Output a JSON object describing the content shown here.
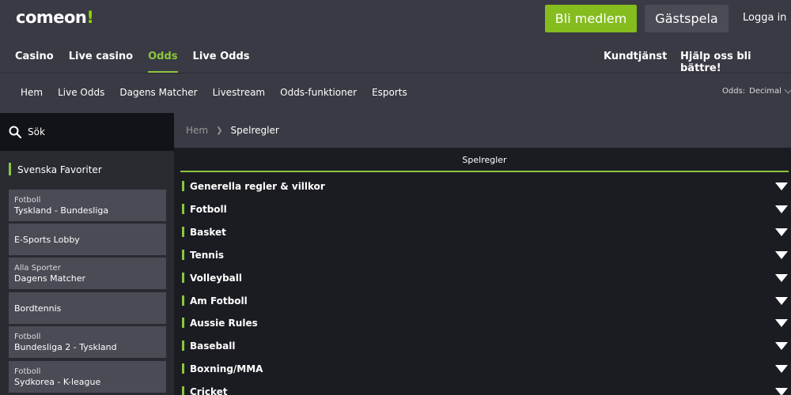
{
  "header": {
    "logo_main": "comeon",
    "logo_suffix": "!",
    "join_label": "Bli medlem",
    "guest_label": "Gästspela",
    "login_label": "Logga in",
    "nav": [
      "Casino",
      "Live casino",
      "Odds",
      "Live Odds"
    ],
    "active_nav": "Odds",
    "support_label": "Kundtjänst",
    "feedback_label": "Hjälp oss bli bättre!"
  },
  "subnav": {
    "links": [
      "Hem",
      "Live Odds",
      "Dagens Matcher",
      "Livestream",
      "Odds-funktioner",
      "Esports"
    ],
    "odds_label": "Odds:",
    "odds_value": "Decimal"
  },
  "sidebar": {
    "search_label": "Sök",
    "favorites_title": "Svenska Favoriter",
    "items": [
      {
        "sport": "Fotboll",
        "name": "Tyskland - Bundesliga"
      },
      {
        "sport": "",
        "name": "E-Sports Lobby"
      },
      {
        "sport": "Alla Sporter",
        "name": "Dagens Matcher"
      },
      {
        "sport": "",
        "name": "Bordtennis"
      },
      {
        "sport": "Fotboll",
        "name": "Bundesliga 2 - Tyskland"
      },
      {
        "sport": "Fotboll",
        "name": "Sydkorea - K-league"
      }
    ]
  },
  "breadcrumb": {
    "home": "Hem",
    "current": "Spelregler"
  },
  "tab_label": "Spelregler",
  "rules": [
    "Generella regler & villkor",
    "Fotboll",
    "Basket",
    "Tennis",
    "Volleyball",
    "Am Fotboll",
    "Aussie Rules",
    "Baseball",
    "Boxning/MMA",
    "Cricket"
  ],
  "colors": {
    "accent": "#8cc63f",
    "join_button": "#85bd1f",
    "header_bg": "#393a43",
    "content_bg": "#1b1c22"
  }
}
